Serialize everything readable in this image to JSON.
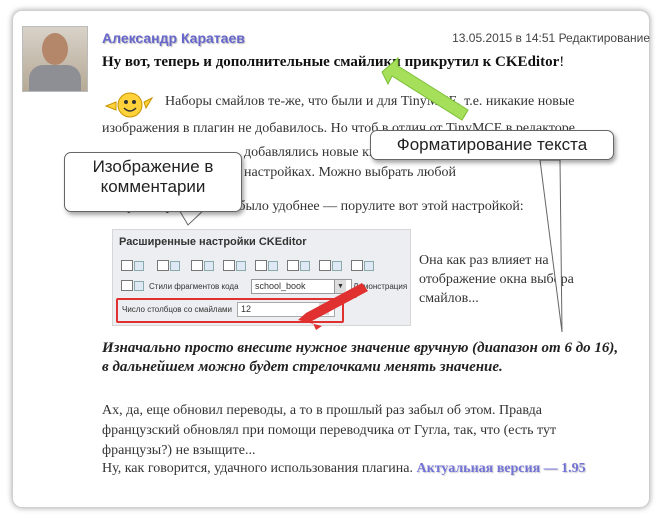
{
  "comment": {
    "author": "Александр Каратаев",
    "date": "13.05.2015 в 14:51",
    "edit_label": "Редактирование",
    "title_text": "Ну вот, теперь и дополнительные смайлики прикрутил к CKEditor",
    "title_suffix": "!",
    "para1_line1": "Наборы смайлов те-же, что были и для TinyMCE, т.е. никакие новые",
    "para1_line2": "изображения в плагин не добавилось. Но чтоб в отлич от TinyMCE в редакторе",
    "para1_line3": "добавлялись новые кнопки, то при исп... выбранные наборы в настройках. Можно выбрать любой",
    "para1_line4": "сетку наборы смайлов было удобнее — порулите вот этой настройкой:",
    "note": "Она как раз влияет на отображение окна выбора смайлов...",
    "bold_italic": "Изначально просто внесите нужное значение вручную (диапазон от 6 до 16), в дальнейшем можно будет стрелочками менять значение.",
    "para2": "Ах, да, еще обновил переводы, а то в прошлый раз забыл об этом. Правда французский обновлял при помощи переводчика от Гугла, так, что (есть тут французы?) не взыщите...",
    "para3_text": "Ну, как говорится, удачного использования плагина. ",
    "link_text": "Актуальная версия — 1.95"
  },
  "screenshot": {
    "title": "Расширенные настройки CKEditor",
    "styles_label": "Стили фрагментов кода",
    "styles_value": "school_book",
    "demo_label": "Демонстрация с",
    "columns_label": "Число столбцов со смайлами",
    "columns_value": "12"
  },
  "callouts": {
    "image_in_comment": "Изображение в комментарии",
    "text_formatting": "Форматирование текста"
  },
  "colors": {
    "author": "#6666cc",
    "link": "#7373d6",
    "green_arrow": "#99dd44",
    "red_arrow": "#e03030"
  }
}
